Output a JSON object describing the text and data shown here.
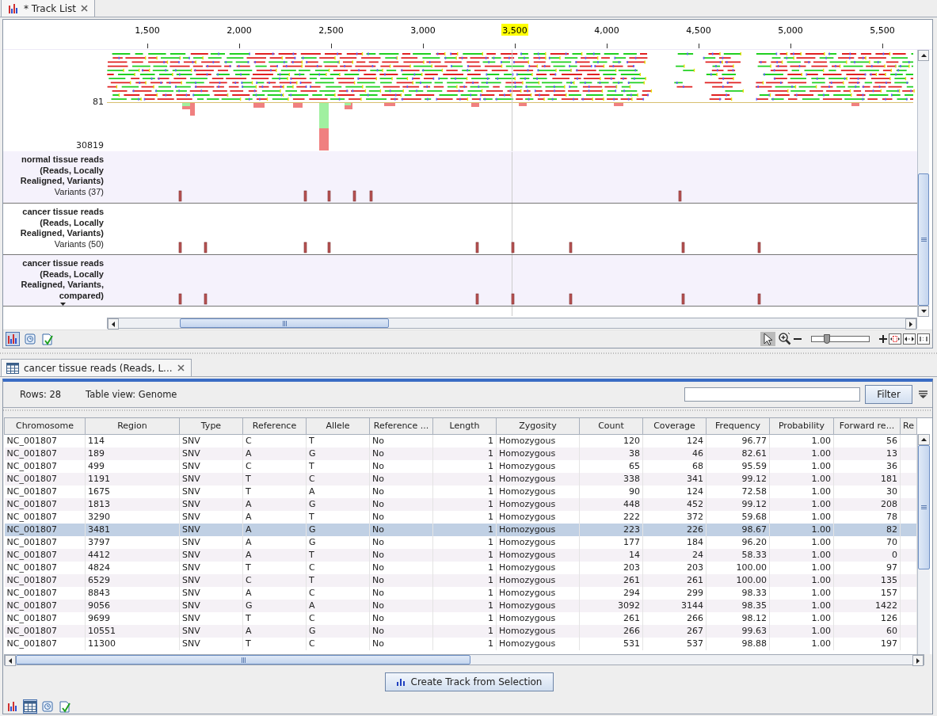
{
  "track_view": {
    "tab": {
      "title": "* Track List"
    },
    "ruler": {
      "ticks": [
        {
          "label": "1,500",
          "highlighted": false
        },
        {
          "label": "2,000",
          "highlighted": false
        },
        {
          "label": "2,500",
          "highlighted": false
        },
        {
          "label": "3,000",
          "highlighted": false
        },
        {
          "label": "3,500",
          "highlighted": true
        },
        {
          "label": "4,000",
          "highlighted": false
        },
        {
          "label": "4,500",
          "highlighted": false
        },
        {
          "label": "5,000",
          "highlighted": false
        },
        {
          "label": "5,500",
          "highlighted": false
        }
      ]
    },
    "reads_track": {
      "axis_labels": [
        "81",
        "30819"
      ]
    },
    "variant_tracks": [
      {
        "title_lines": [
          "normal tissue reads",
          "(Reads, Locally",
          "Realigned, Variants)"
        ],
        "subtitle": "Variants (37)",
        "expand_arrow": false
      },
      {
        "title_lines": [
          "cancer tissue reads",
          "(Reads, Locally",
          "Realigned, Variants)"
        ],
        "subtitle": "Variants (50)",
        "expand_arrow": false
      },
      {
        "title_lines": [
          "cancer tissue reads",
          "(Reads, Locally",
          "Realigned, Variants,",
          "compared)"
        ],
        "expand_arrow": true
      }
    ],
    "view_buttons": [
      {
        "kind": "tracks",
        "selected": true
      },
      {
        "kind": "history",
        "selected": false
      },
      {
        "kind": "annotations",
        "selected": false
      }
    ],
    "tools": [
      {
        "kind": "select",
        "selected": true
      },
      {
        "kind": "zoom",
        "selected": false
      }
    ],
    "zoom_slider": {
      "level": 0.27
    }
  },
  "table_view": {
    "tab": {
      "title": "cancer tissue reads (Reads, L..."
    },
    "rows_count": "Rows: 28",
    "table_view_label": "Table view: Genome",
    "filter_button": "Filter",
    "columns": [
      {
        "label": "Chromosome",
        "kind": "text"
      },
      {
        "label": "Region",
        "kind": "text"
      },
      {
        "label": "Type",
        "kind": "text"
      },
      {
        "label": "Reference",
        "kind": "text"
      },
      {
        "label": "Allele",
        "kind": "text"
      },
      {
        "label": "Reference ...",
        "kind": "text"
      },
      {
        "label": "Length",
        "kind": "number"
      },
      {
        "label": "Zygosity",
        "kind": "text"
      },
      {
        "label": "Count",
        "kind": "number"
      },
      {
        "label": "Coverage",
        "kind": "number"
      },
      {
        "label": "Frequency",
        "kind": "number"
      },
      {
        "label": "Probability",
        "kind": "number"
      },
      {
        "label": "Forward re...",
        "kind": "number"
      },
      {
        "label": "Re",
        "kind": "number"
      }
    ],
    "rows": [
      {
        "selected": false,
        "cells": [
          "NC_001807",
          "114",
          "SNV",
          "C",
          "T",
          "No",
          "1",
          "Homozygous",
          "120",
          "124",
          "96.77",
          "1.00",
          "56"
        ]
      },
      {
        "selected": false,
        "cells": [
          "NC_001807",
          "189",
          "SNV",
          "A",
          "G",
          "No",
          "1",
          "Homozygous",
          "38",
          "46",
          "82.61",
          "1.00",
          "13"
        ]
      },
      {
        "selected": false,
        "cells": [
          "NC_001807",
          "499",
          "SNV",
          "C",
          "T",
          "No",
          "1",
          "Homozygous",
          "65",
          "68",
          "95.59",
          "1.00",
          "36"
        ]
      },
      {
        "selected": false,
        "cells": [
          "NC_001807",
          "1191",
          "SNV",
          "T",
          "C",
          "No",
          "1",
          "Homozygous",
          "338",
          "341",
          "99.12",
          "1.00",
          "181"
        ]
      },
      {
        "selected": false,
        "cells": [
          "NC_001807",
          "1675",
          "SNV",
          "T",
          "A",
          "No",
          "1",
          "Homozygous",
          "90",
          "124",
          "72.58",
          "1.00",
          "30"
        ]
      },
      {
        "selected": false,
        "cells": [
          "NC_001807",
          "1813",
          "SNV",
          "A",
          "G",
          "No",
          "1",
          "Homozygous",
          "448",
          "452",
          "99.12",
          "1.00",
          "208"
        ]
      },
      {
        "selected": false,
        "cells": [
          "NC_001807",
          "3290",
          "SNV",
          "A",
          "T",
          "No",
          "1",
          "Homozygous",
          "222",
          "372",
          "59.68",
          "1.00",
          "78"
        ]
      },
      {
        "selected": true,
        "cells": [
          "NC_001807",
          "3481",
          "SNV",
          "A",
          "G",
          "No",
          "1",
          "Homozygous",
          "223",
          "226",
          "98.67",
          "1.00",
          "82"
        ]
      },
      {
        "selected": false,
        "cells": [
          "NC_001807",
          "3797",
          "SNV",
          "A",
          "G",
          "No",
          "1",
          "Homozygous",
          "177",
          "184",
          "96.20",
          "1.00",
          "70"
        ]
      },
      {
        "selected": false,
        "cells": [
          "NC_001807",
          "4412",
          "SNV",
          "A",
          "T",
          "No",
          "1",
          "Homozygous",
          "14",
          "24",
          "58.33",
          "1.00",
          "0"
        ]
      },
      {
        "selected": false,
        "cells": [
          "NC_001807",
          "4824",
          "SNV",
          "T",
          "C",
          "No",
          "1",
          "Homozygous",
          "203",
          "203",
          "100.00",
          "1.00",
          "97"
        ]
      },
      {
        "selected": false,
        "cells": [
          "NC_001807",
          "6529",
          "SNV",
          "C",
          "T",
          "No",
          "1",
          "Homozygous",
          "261",
          "261",
          "100.00",
          "1.00",
          "135"
        ]
      },
      {
        "selected": false,
        "cells": [
          "NC_001807",
          "8843",
          "SNV",
          "A",
          "C",
          "No",
          "1",
          "Homozygous",
          "294",
          "299",
          "98.33",
          "1.00",
          "157"
        ]
      },
      {
        "selected": false,
        "cells": [
          "NC_001807",
          "9056",
          "SNV",
          "G",
          "A",
          "No",
          "1",
          "Homozygous",
          "3092",
          "3144",
          "98.35",
          "1.00",
          "1422"
        ]
      },
      {
        "selected": false,
        "cells": [
          "NC_001807",
          "9699",
          "SNV",
          "T",
          "C",
          "No",
          "1",
          "Homozygous",
          "261",
          "266",
          "98.12",
          "1.00",
          "126"
        ]
      },
      {
        "selected": false,
        "cells": [
          "NC_001807",
          "10551",
          "SNV",
          "A",
          "G",
          "No",
          "1",
          "Homozygous",
          "266",
          "267",
          "99.63",
          "1.00",
          "60"
        ]
      },
      {
        "selected": false,
        "cells": [
          "NC_001807",
          "11300",
          "SNV",
          "T",
          "C",
          "No",
          "1",
          "Homozygous",
          "531",
          "537",
          "98.88",
          "1.00",
          "197"
        ]
      }
    ],
    "create_button": "Create Track from Selection",
    "view_buttons": [
      {
        "kind": "tracks",
        "selected": false
      },
      {
        "kind": "table",
        "selected": true
      },
      {
        "kind": "history",
        "selected": false
      },
      {
        "kind": "annotations",
        "selected": false
      }
    ]
  }
}
